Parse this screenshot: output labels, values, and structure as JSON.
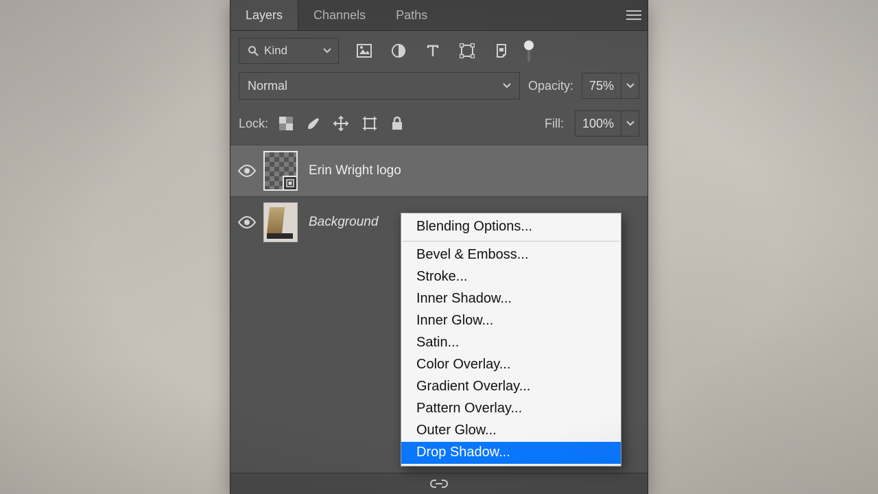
{
  "tabs": {
    "layers": "Layers",
    "channels": "Channels",
    "paths": "Paths"
  },
  "filter": {
    "kind_label": "Kind"
  },
  "blend": {
    "mode": "Normal",
    "opacity_label": "Opacity:",
    "opacity_value": "75%"
  },
  "lock": {
    "label": "Lock:",
    "fill_label": "Fill:",
    "fill_value": "100%"
  },
  "layers": [
    {
      "name": "Erin Wright logo",
      "selected": true,
      "smart": true,
      "italic": false
    },
    {
      "name": "Background",
      "selected": false,
      "smart": false,
      "italic": true
    }
  ],
  "menu": {
    "blending_options": "Blending Options...",
    "items": [
      "Bevel & Emboss...",
      "Stroke...",
      "Inner Shadow...",
      "Inner Glow...",
      "Satin...",
      "Color Overlay...",
      "Gradient Overlay...",
      "Pattern Overlay...",
      "Outer Glow...",
      "Drop Shadow..."
    ],
    "selected_index": 9
  }
}
